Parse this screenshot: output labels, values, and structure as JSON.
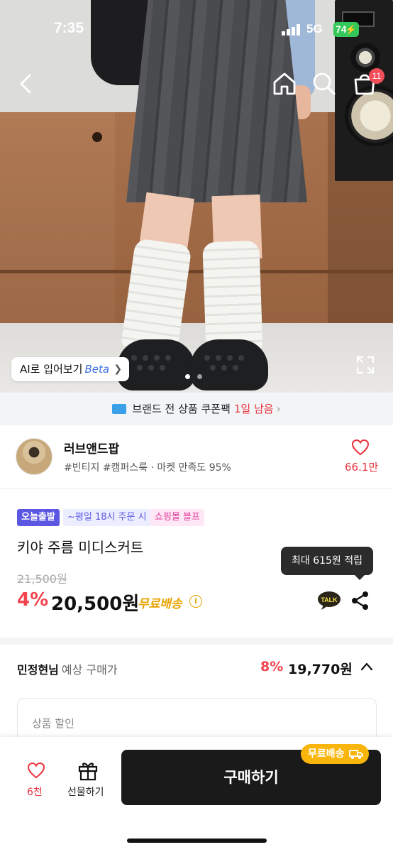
{
  "status_bar": {
    "time": "7:35",
    "network": "5G",
    "battery": "74"
  },
  "nav": {
    "cart_count": "11"
  },
  "hero": {
    "ai_try_on": "AI로 입어보기",
    "ai_beta": "Beta",
    "image_count": 2,
    "active_image": 1
  },
  "coupon_banner": {
    "text": "브랜드 전 상품 쿠폰팩",
    "highlight": "1일 남음"
  },
  "seller": {
    "name": "러브앤드팝",
    "tags": "#빈티지 #캠퍼스룩 · 마켓 만족도 95%",
    "likes": "66.1만"
  },
  "product": {
    "badges": {
      "today": "오늘출발",
      "cutoff": "~평일 18시 주문 시",
      "mall": "쇼핑몰 블프"
    },
    "title": "키야 주름 미디스커트",
    "original_price": "21,500원",
    "discount": "4%",
    "price": "20,500원",
    "free_shipping": "무료배송",
    "points_tooltip": "최대 615원 적립"
  },
  "expected_price": {
    "user": "민정현님",
    "label": "예상 구매가",
    "discount": "8%",
    "price": "19,770원",
    "section_label": "상품 할인"
  },
  "bottom_bar": {
    "likes": "6천",
    "gift_label": "선물하기",
    "buy_label": "구매하기",
    "shipping_pill": "무료배송"
  },
  "colors": {
    "accent_red": "#f2444f",
    "brand_purple": "#5b57e3",
    "shipping_yellow": "#fab50a"
  }
}
